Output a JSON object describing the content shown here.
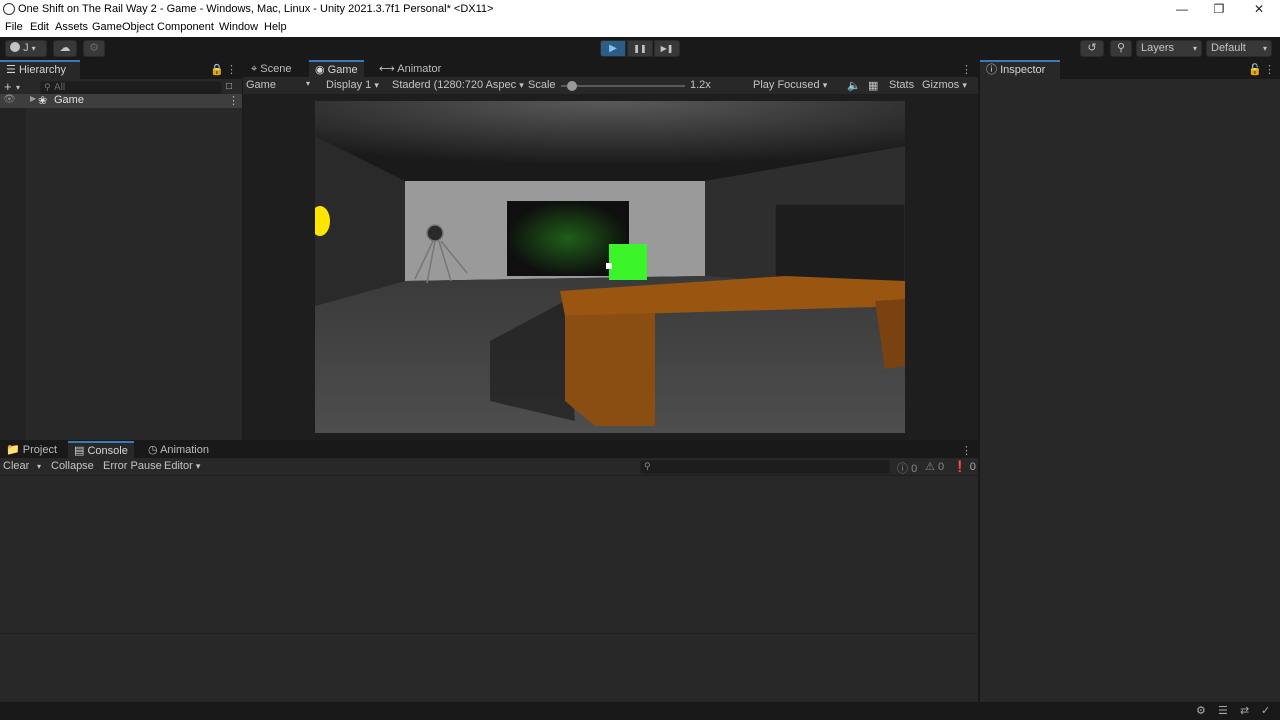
{
  "window": {
    "title": "One Shift on The Rail Way 2 - Game - Windows, Mac, Linux - Unity 2021.3.7f1 Personal* <DX11>",
    "minimize_glyph": "—",
    "restore_glyph": "❐",
    "close_glyph": "✕"
  },
  "menu": [
    "File",
    "Edit",
    "Assets",
    "GameObject",
    "Component",
    "Window",
    "Help"
  ],
  "toolbar": {
    "account_label": "J",
    "play_glyph": "▶",
    "pause_glyph": "❚❚",
    "step_glyph": "▶❚",
    "layers_label": "Layers",
    "layout_label": "Default",
    "play_state_color": "#2c5d87"
  },
  "hierarchy": {
    "tab_label": "Hierarchy",
    "search_placeholder": "All",
    "scene_name": "Game"
  },
  "center_tabs": {
    "scene": "Scene",
    "game": "Game",
    "animator": "Animator"
  },
  "game_toolbar": {
    "view_mode": "Game",
    "display": "Display 1",
    "aspect": "Staderd (1280:720 Aspec",
    "scale_label": "Scale",
    "scale_value": "1.2x",
    "scale_fraction": 0.05,
    "play_focused": "Play Focused",
    "stats": "Stats",
    "gizmos": "Gizmos"
  },
  "inspector": {
    "tab_label": "Inspector"
  },
  "bottom_tabs": {
    "project": "Project",
    "console": "Console",
    "animation": "Animation"
  },
  "console_toolbar": {
    "clear": "Clear",
    "collapse": "Collapse",
    "error_pause": "Error Pause",
    "editor": "Editor",
    "log_count": "0",
    "warning_count": "0",
    "error_count": "0"
  },
  "colors": {
    "accent_blue": "#3a79bb",
    "panel_bg": "#282828",
    "dark_bg": "#191919",
    "green_cube": "#3bf52a",
    "table_orange": "#8a4d12"
  }
}
